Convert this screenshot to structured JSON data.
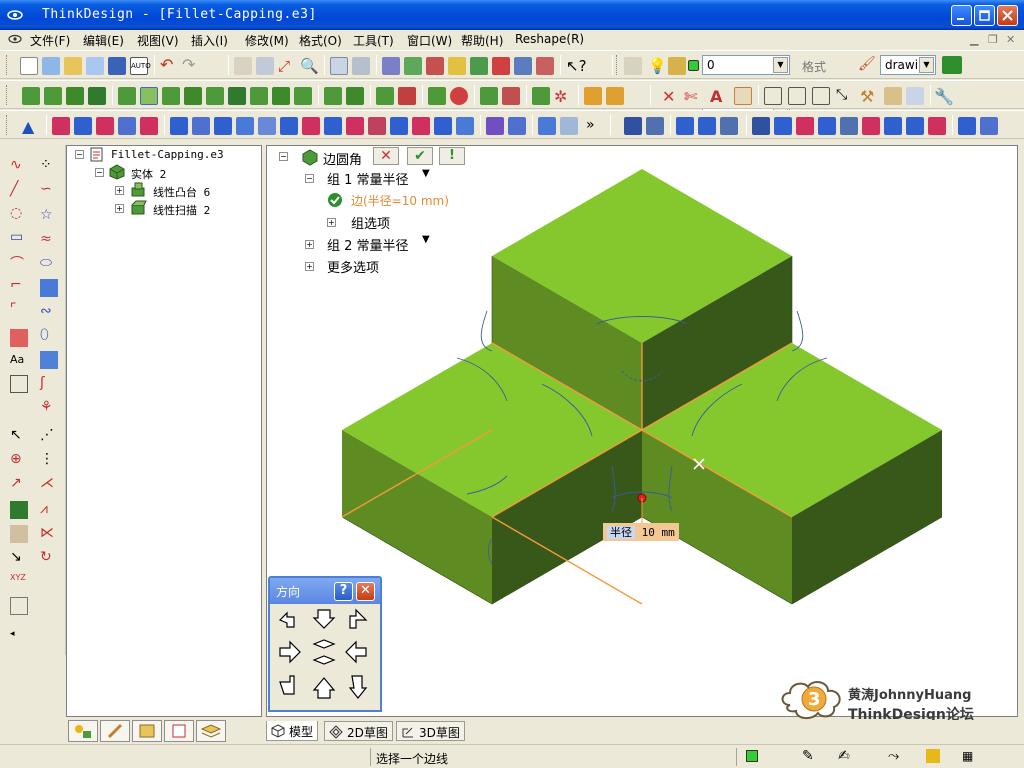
{
  "window": {
    "app_name": "ThinkDesign",
    "title": "ThinkDesign  - [Fillet-Capping.e3]"
  },
  "menu": [
    "文件(F)",
    "编辑(E)",
    "视图(V)",
    "插入(I)",
    "修改(M)",
    "格式(O)",
    "工具(T)",
    "窗口(W)",
    "帮助(H)",
    "Reshape(R)"
  ],
  "toolbar": {
    "layer_value": "0",
    "format_label": "格式",
    "style_value": "drawir",
    "layer_color": "#33CC33"
  },
  "tree": {
    "root": "Fillet-Capping.e3",
    "solid": "实体 2",
    "children": [
      "线性凸台 6",
      "线性扫描 2"
    ]
  },
  "fillet_panel": {
    "title": "边圆角",
    "group1": "组 1 常量半径",
    "edge": "边(半径=10 mm)",
    "group_options": "组选项",
    "group2": "组 2 常量半径",
    "more_options": "更多选项"
  },
  "dimension": {
    "label": "半径",
    "value": "10 mm"
  },
  "direction_dialog": {
    "title": "方向",
    "help": "?"
  },
  "view_tabs": [
    "模型",
    "2D草图",
    "3D草图"
  ],
  "status": {
    "message": "选择一个边线"
  },
  "watermark": {
    "number": "3",
    "line1": "黄涛JohnnyHuang",
    "line2": "ThinkDesign论坛"
  },
  "colors": {
    "top_face": "#85C82E",
    "side_light": "#5E8B22",
    "side_dark": "#38581A",
    "fillet_edge": "#F39A3A",
    "curve": "#3B5C9B"
  }
}
